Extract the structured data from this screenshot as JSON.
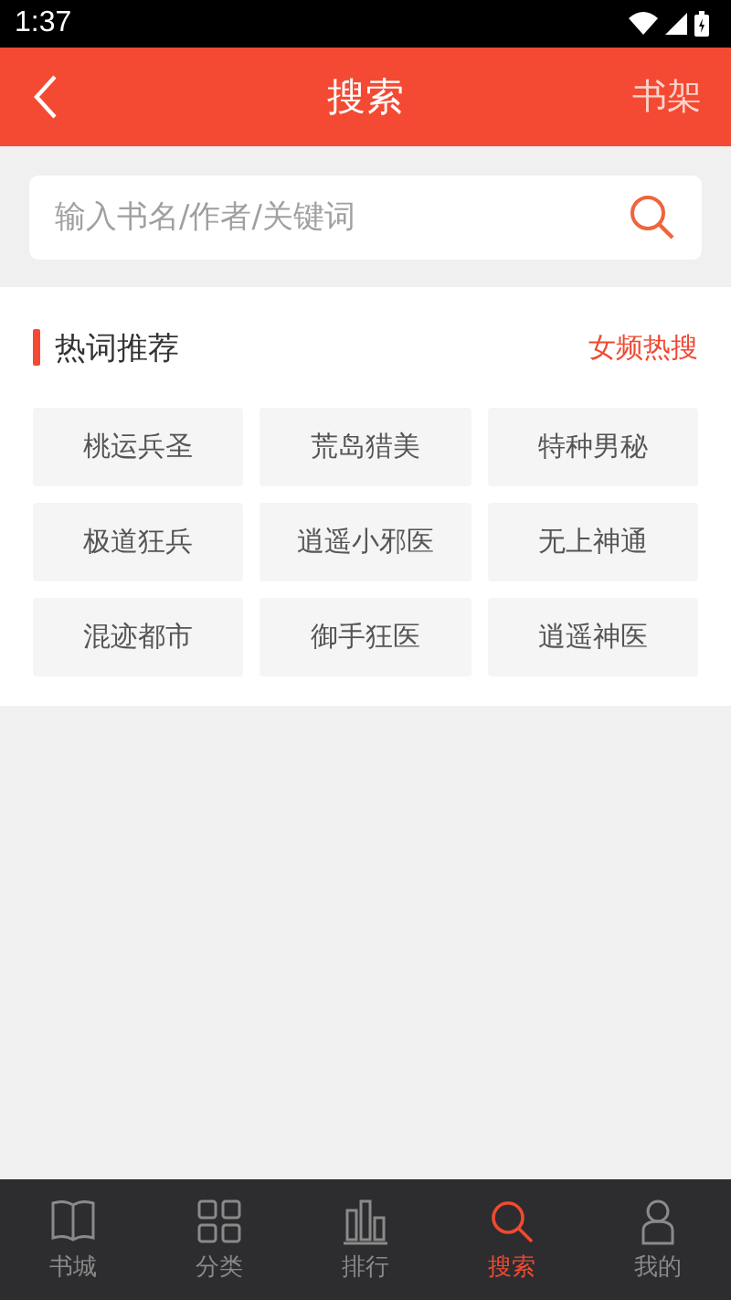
{
  "status_bar": {
    "time": "1:37"
  },
  "header": {
    "title": "搜索",
    "right_link": "书架"
  },
  "search": {
    "placeholder": "输入书名/作者/关键词"
  },
  "hot_words": {
    "title": "热词推荐",
    "switch_link": "女频热搜",
    "words": [
      "桃运兵圣",
      "荒岛猎美",
      "特种男秘",
      "极道狂兵",
      "逍遥小邪医",
      "无上神通",
      "混迹都市",
      "御手狂医",
      "逍遥神医"
    ]
  },
  "tab_bar": [
    {
      "label": "书城",
      "kind": "book",
      "selected": false
    },
    {
      "label": "分类",
      "kind": "grid",
      "selected": false
    },
    {
      "label": "排行",
      "kind": "chart",
      "selected": false
    },
    {
      "label": "搜索",
      "kind": "search",
      "selected": true
    },
    {
      "label": "我的",
      "kind": "person",
      "selected": false
    }
  ]
}
